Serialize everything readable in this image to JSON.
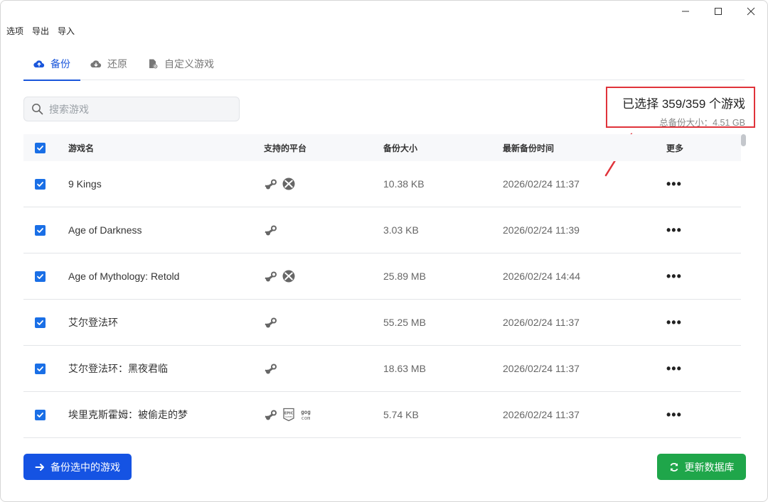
{
  "window_controls": {
    "minimize": "minimize",
    "maximize": "maximize",
    "close": "close"
  },
  "menu": [
    "选项",
    "导出",
    "导入"
  ],
  "tabs": [
    {
      "label": "备份",
      "icon": "cloud-upload-icon",
      "active": true
    },
    {
      "label": "还原",
      "icon": "cloud-download-icon",
      "active": false
    },
    {
      "label": "自定义游戏",
      "icon": "file-gear-icon",
      "active": false
    }
  ],
  "search": {
    "placeholder": "搜索游戏",
    "value": ""
  },
  "summary": {
    "selected": "已选择 359/359 个游戏",
    "total_size": "总备份大小：4.51 GB"
  },
  "table": {
    "headers": {
      "name": "游戏名",
      "platform": "支持的平台",
      "size": "备份大小",
      "time": "最新备份时间",
      "more": "更多"
    },
    "rows": [
      {
        "checked": true,
        "name": "9 Kings",
        "platforms": [
          "steam",
          "xbox"
        ],
        "size": "10.38 KB",
        "time": "2026/02/24 11:37",
        "more": "•••"
      },
      {
        "checked": true,
        "name": "Age of Darkness",
        "platforms": [
          "steam"
        ],
        "size": "3.03 KB",
        "time": "2026/02/24 11:39",
        "more": "•••"
      },
      {
        "checked": true,
        "name": "Age of Mythology: Retold",
        "platforms": [
          "steam",
          "xbox"
        ],
        "size": "25.89 MB",
        "time": "2026/02/24 14:44",
        "more": "•••"
      },
      {
        "checked": true,
        "name": "艾尔登法环",
        "platforms": [
          "steam"
        ],
        "size": "55.25 MB",
        "time": "2026/02/24 11:37",
        "more": "•••"
      },
      {
        "checked": true,
        "name": "艾尔登法环：黑夜君临",
        "platforms": [
          "steam"
        ],
        "size": "18.63 MB",
        "time": "2026/02/24 11:37",
        "more": "•••"
      },
      {
        "checked": true,
        "name": "埃里克斯霍姆：被偷走的梦",
        "platforms": [
          "steam",
          "epic",
          "gog"
        ],
        "size": "5.74 KB",
        "time": "2026/02/24 11:37",
        "more": "•••"
      }
    ]
  },
  "buttons": {
    "backup": "备份选中的游戏",
    "update": "更新数据库"
  },
  "colors": {
    "accent": "#1553e3",
    "success": "#1fa64a",
    "highlight": "#e0333a"
  }
}
